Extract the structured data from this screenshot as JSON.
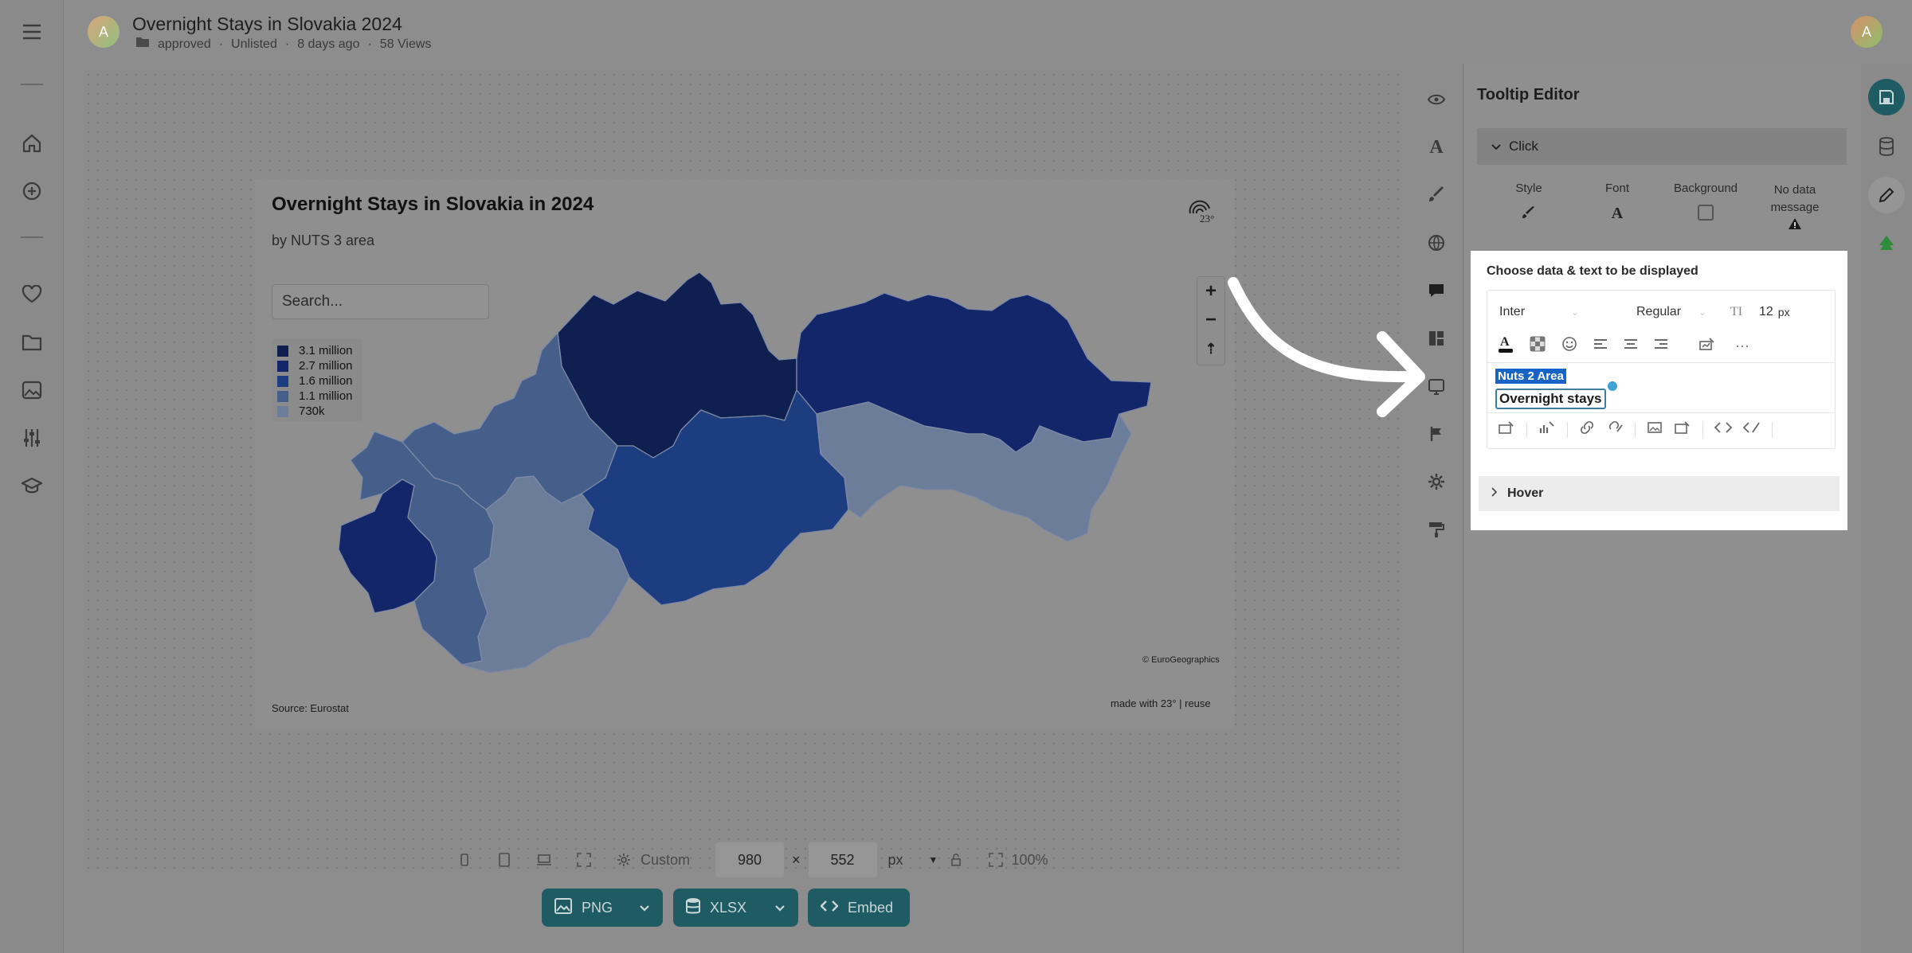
{
  "header": {
    "avatar_letter": "A",
    "title": "Overnight Stays in Slovakia 2024",
    "folder": "approved",
    "visibility": "Unlisted",
    "age": "8 days ago",
    "views": "58 Views",
    "user_avatar_letter": "A"
  },
  "left_rail": {
    "icons": [
      "menu-icon",
      "home-icon",
      "add-icon",
      "heart-icon",
      "folder-icon",
      "image-icon",
      "sliders-icon",
      "graduation-cap-icon"
    ]
  },
  "chart": {
    "title": "Overnight Stays in Slovakia in 2024",
    "subtitle": "by NUTS 3 area",
    "search_placeholder": "Search...",
    "legend": [
      {
        "label": "3.1 million",
        "color": "#0f1f4f"
      },
      {
        "label": "2.7 million",
        "color": "#14266a"
      },
      {
        "label": "1.6 million",
        "color": "#1c3d7f"
      },
      {
        "label": "1.1 million",
        "color": "#455f8a"
      },
      {
        "label": "730k",
        "color": "#6c7d99"
      }
    ],
    "zoom_in": "+",
    "zoom_out": "−",
    "reset": "⇡",
    "copyright": "© EuroGeographics",
    "source": "Source: Eurostat",
    "made_with": "made with 23° | reuse",
    "logo_text": "23°"
  },
  "bottom": {
    "preset": "Custom",
    "width": "980",
    "times": "×",
    "height": "552",
    "unit": "px",
    "zoom": "100%",
    "png": "PNG",
    "xlsx": "XLSX",
    "embed": "Embed"
  },
  "panel": {
    "title": "Tooltip Editor",
    "click_label": "Click",
    "options": [
      "Style",
      "Font",
      "Background",
      "No data message"
    ],
    "choose_label": "Choose data & text to be displayed",
    "font": "Inter",
    "weight": "Regular",
    "size_value": "12",
    "size_unit": "px",
    "tag_area": "Nuts 2 Area",
    "tag_stays": "Overnight stays",
    "hover_label": "Hover"
  },
  "colors": {
    "accent": "#1f5b63",
    "highlight": "#1763c6",
    "green_logo": "#2e8b3a"
  }
}
